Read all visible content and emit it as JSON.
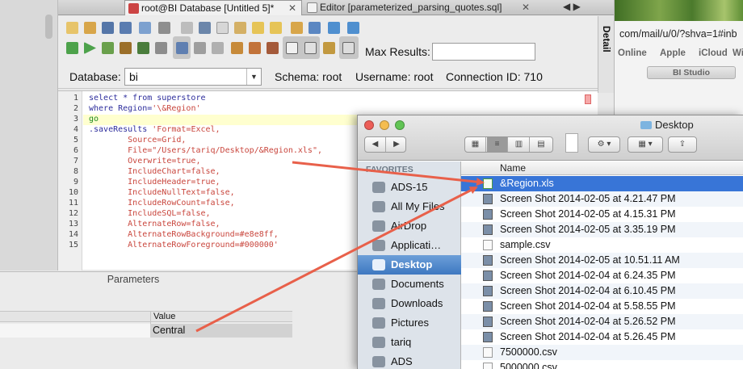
{
  "browser": {
    "url_fragment": "com/mail/u/0/?shva=1#inb",
    "bookmarks": [
      "Online",
      "Apple",
      "iCloud",
      "Wi"
    ],
    "tab_label": "BI Studio"
  },
  "db_tool": {
    "tabs": [
      {
        "label": "root@BI Database [Untitled 5]*",
        "close": "✕"
      },
      {
        "label": "Editor [parameterized_parsing_quotes.sql]",
        "close": "✕"
      }
    ],
    "tab_arrows": "◀ ▶",
    "detail_label": "Detail",
    "max_results_label": "Max Results:",
    "max_results_value": "",
    "database_label": "Database:",
    "database_value": "bi",
    "schema_label": "Schema:",
    "schema_value": "root",
    "username_label": "Username:",
    "username_value": "root",
    "connection_label": "Connection ID:",
    "connection_value": "710",
    "line_numbers": [
      "1",
      "2",
      "3",
      "4",
      "5",
      "6",
      "7",
      "8",
      "9",
      "10",
      "11",
      "12",
      "13",
      "14",
      "15"
    ],
    "code": [
      [
        {
          "t": "select * from superstore",
          "c": "kw"
        }
      ],
      [
        {
          "t": "where Region=",
          "c": "kw"
        },
        {
          "t": "'\\&Region'",
          "c": "str"
        }
      ],
      [
        {
          "t": "go",
          "c": "kw2"
        }
      ],
      [
        {
          "t": ".saveResults ",
          "c": "kw"
        },
        {
          "t": "'Format=Excel,",
          "c": "str"
        }
      ],
      [
        {
          "t": "        Source=Grid,",
          "c": "str"
        }
      ],
      [
        {
          "t": "        File=\"/Users/tariq/Desktop/&Region.xls\",",
          "c": "str"
        }
      ],
      [
        {
          "t": "        Overwrite=true,",
          "c": "str"
        }
      ],
      [
        {
          "t": "        IncludeChart=false,",
          "c": "str"
        }
      ],
      [
        {
          "t": "        IncludeHeader=true,",
          "c": "str"
        }
      ],
      [
        {
          "t": "        IncludeNullText=false,",
          "c": "str"
        }
      ],
      [
        {
          "t": "        IncludeRowCount=false,",
          "c": "str"
        }
      ],
      [
        {
          "t": "        IncludeSQL=false,",
          "c": "str"
        }
      ],
      [
        {
          "t": "        AlternateRow=false,",
          "c": "str"
        }
      ],
      [
        {
          "t": "        AlternateRowBackground=#e8e8ff,",
          "c": "str"
        }
      ],
      [
        {
          "t": "        AlternateRowForeground=#000000'",
          "c": "str"
        }
      ]
    ],
    "params": {
      "title": "Parameters",
      "column_header": "Value",
      "value": "Central"
    },
    "colors": {
      "string": "#c9463d",
      "keyword": "#2d2d9c",
      "go": "#1f8b1f",
      "current_line": "#ffffcf"
    }
  },
  "finder": {
    "title": "Desktop",
    "nav": {
      "back": "◀",
      "forward": "▶"
    },
    "sidebar_section": "FAVORITES",
    "sidebar_items": [
      {
        "label": "ADS-15",
        "selected": false
      },
      {
        "label": "All My Files",
        "selected": false
      },
      {
        "label": "AirDrop",
        "selected": false
      },
      {
        "label": "Applicati…",
        "selected": false
      },
      {
        "label": "Desktop",
        "selected": true
      },
      {
        "label": "Documents",
        "selected": false
      },
      {
        "label": "Downloads",
        "selected": false
      },
      {
        "label": "Pictures",
        "selected": false
      },
      {
        "label": "tariq",
        "selected": false
      },
      {
        "label": "ADS",
        "selected": false
      }
    ],
    "column_name": "Name",
    "files": [
      {
        "name": "&Region.xls",
        "type": "xls",
        "selected": true
      },
      {
        "name": "Screen Shot 2014-02-05 at 4.21.47 PM",
        "type": "img",
        "selected": false
      },
      {
        "name": "Screen Shot 2014-02-05 at 4.15.31 PM",
        "type": "img",
        "selected": false
      },
      {
        "name": "Screen Shot 2014-02-05 at 3.35.19 PM",
        "type": "img",
        "selected": false
      },
      {
        "name": "sample.csv",
        "type": "doc",
        "selected": false
      },
      {
        "name": "Screen Shot 2014-02-05 at 10.51.11 AM",
        "type": "img",
        "selected": false
      },
      {
        "name": "Screen Shot 2014-02-04 at 6.24.35 PM",
        "type": "img",
        "selected": false
      },
      {
        "name": "Screen Shot 2014-02-04 at 6.10.45 PM",
        "type": "img",
        "selected": false
      },
      {
        "name": "Screen Shot 2014-02-04 at 5.58.55 PM",
        "type": "img",
        "selected": false
      },
      {
        "name": "Screen Shot 2014-02-04 at 5.26.52 PM",
        "type": "img",
        "selected": false
      },
      {
        "name": "Screen Shot 2014-02-04 at 5.26.45 PM",
        "type": "img",
        "selected": false
      },
      {
        "name": "7500000.csv",
        "type": "doc",
        "selected": false
      },
      {
        "name": "5000000.csv",
        "type": "doc",
        "selected": false
      }
    ]
  },
  "annotation": {
    "arrow_color": "#e8604a"
  }
}
